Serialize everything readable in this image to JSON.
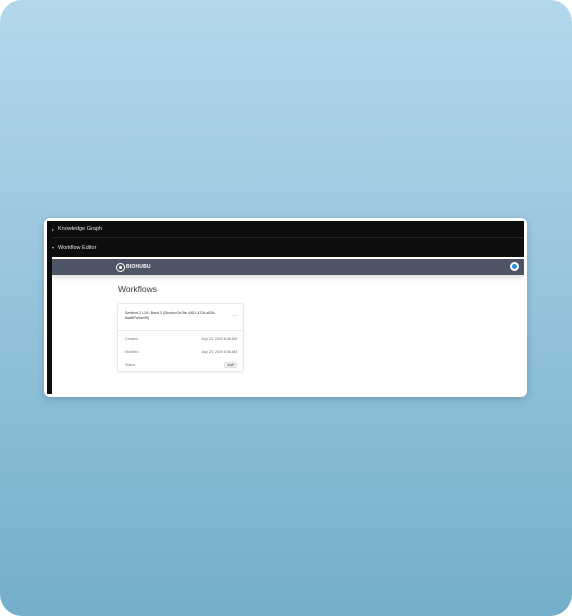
{
  "tabs": [
    {
      "label": "Knowledge Graph"
    },
    {
      "label": "Workflow Editor"
    }
  ],
  "header": {
    "logo_text": "BIOHUBU",
    "logo_icon": "brand-logo-icon",
    "action_icon": "circle-status-icon"
  },
  "main": {
    "title": "Workflows"
  },
  "workflow_card": {
    "title": "Sentinel-2 L2A: Band 2 (Sinchez2e15e-4451-472d-a53b-6ad8f7a5ae99)",
    "menu": "···",
    "rows": [
      {
        "label": "Created",
        "value": "July 23, 2024 8:46 AM"
      },
      {
        "label": "Modified",
        "value": "July 23, 2024 8:46 AM"
      },
      {
        "label": "Status",
        "value": "draft"
      }
    ]
  },
  "colors": {
    "header": "#4d5566",
    "dark_bar": "#0d0d0d",
    "accent": "#2b8fd9"
  }
}
